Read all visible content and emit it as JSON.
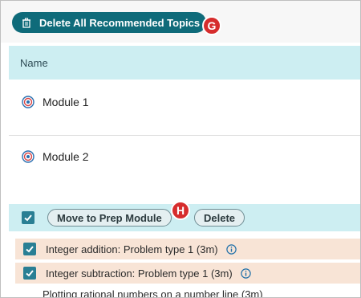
{
  "toolbar": {
    "delete_all_label": "Delete All Recommended Topics"
  },
  "markers": {
    "g": "G",
    "h": "H"
  },
  "table": {
    "header_name": "Name"
  },
  "modules": [
    {
      "label": "Module 1"
    },
    {
      "label": "Module 2"
    }
  ],
  "action_bar": {
    "move_label": "Move to Prep Module",
    "delete_label": "Delete"
  },
  "topics": [
    {
      "label": "Integer addition: Problem type 1 (3m)",
      "checked": true
    },
    {
      "label": "Integer subtraction: Problem type 1 (3m)",
      "checked": true
    },
    {
      "label": "Plotting rational numbers on a number line (3m)"
    }
  ],
  "colors": {
    "primary_button": "#0f6b7a",
    "header_bg": "#cdeef2",
    "topic_bg": "#f8e4d6",
    "marker": "#d62d2d",
    "checkbox": "#2a7f94"
  },
  "icons": {
    "delete_all": "trash-icon",
    "module": "target-icon",
    "topic_info": "info-icon",
    "checkbox": "checkmark-icon"
  }
}
